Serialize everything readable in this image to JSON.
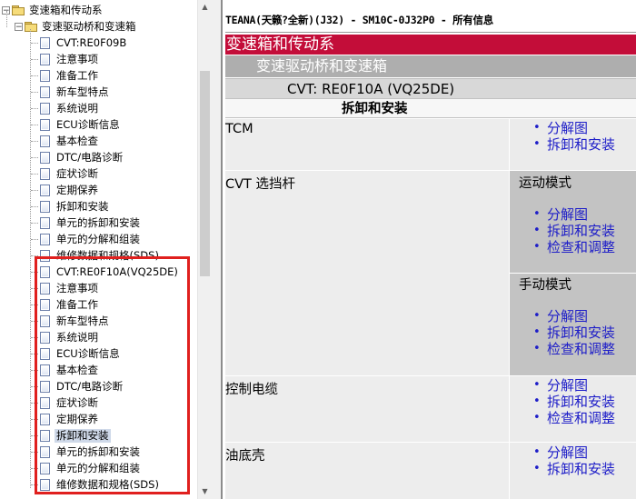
{
  "tree": {
    "root": {
      "label": "变速箱和传动系",
      "expand": "−"
    },
    "child": {
      "label": "变速驱动桥和变速箱",
      "expand": "−"
    },
    "items": [
      {
        "label": "CVT:RE0F09B"
      },
      {
        "label": "注意事项"
      },
      {
        "label": "准备工作"
      },
      {
        "label": "新车型特点"
      },
      {
        "label": "系统说明"
      },
      {
        "label": "ECU诊断信息"
      },
      {
        "label": "基本检查"
      },
      {
        "label": "DTC/电路诊断"
      },
      {
        "label": "症状诊断"
      },
      {
        "label": "定期保养"
      },
      {
        "label": "拆卸和安装"
      },
      {
        "label": "单元的拆卸和安装"
      },
      {
        "label": "单元的分解和组装"
      },
      {
        "label": "维修数据和规格(SDS)"
      },
      {
        "label": "CVT:RE0F10A(VQ25DE)"
      },
      {
        "label": "注意事项"
      },
      {
        "label": "准备工作"
      },
      {
        "label": "新车型特点"
      },
      {
        "label": "系统说明"
      },
      {
        "label": "ECU诊断信息"
      },
      {
        "label": "基本检查"
      },
      {
        "label": "DTC/电路诊断"
      },
      {
        "label": "症状诊断"
      },
      {
        "label": "定期保养"
      },
      {
        "label": "拆卸和安装",
        "selected": true
      },
      {
        "label": "单元的拆卸和安装"
      },
      {
        "label": "单元的分解和组装"
      },
      {
        "label": "维修数据和规格(SDS)"
      }
    ],
    "scroll_up": "▲",
    "scroll_down": "▼"
  },
  "content": {
    "doc_title": "TEANA(天籁?全新)(J32) - SM10C-0J32P0 - 所有信息",
    "category": "变速箱和传动系",
    "subcategory": "变速驱动桥和变速箱",
    "model": "CVT: RE0F10A (VQ25DE)",
    "section": "拆卸和安装",
    "rows": [
      {
        "label": "TCM",
        "links": [
          "分解图",
          "拆卸和安装"
        ]
      },
      {
        "label": "CVT 选挡杆",
        "modes": [
          {
            "label": "运动模式",
            "links": [
              "分解图",
              "拆卸和安装",
              "检查和调整"
            ]
          },
          {
            "label": "手动模式",
            "links": [
              "分解图",
              "拆卸和安装",
              "检查和调整"
            ]
          }
        ]
      },
      {
        "label": "控制电缆",
        "links": [
          "分解图",
          "拆卸和安装",
          "检查和调整"
        ]
      },
      {
        "label": "油底壳",
        "links": [
          "分解图",
          "拆卸和安装"
        ]
      }
    ]
  },
  "colors": {
    "category_bar": "#c30d39",
    "link": "#1e1ec8",
    "highlight": "#e0201e"
  }
}
